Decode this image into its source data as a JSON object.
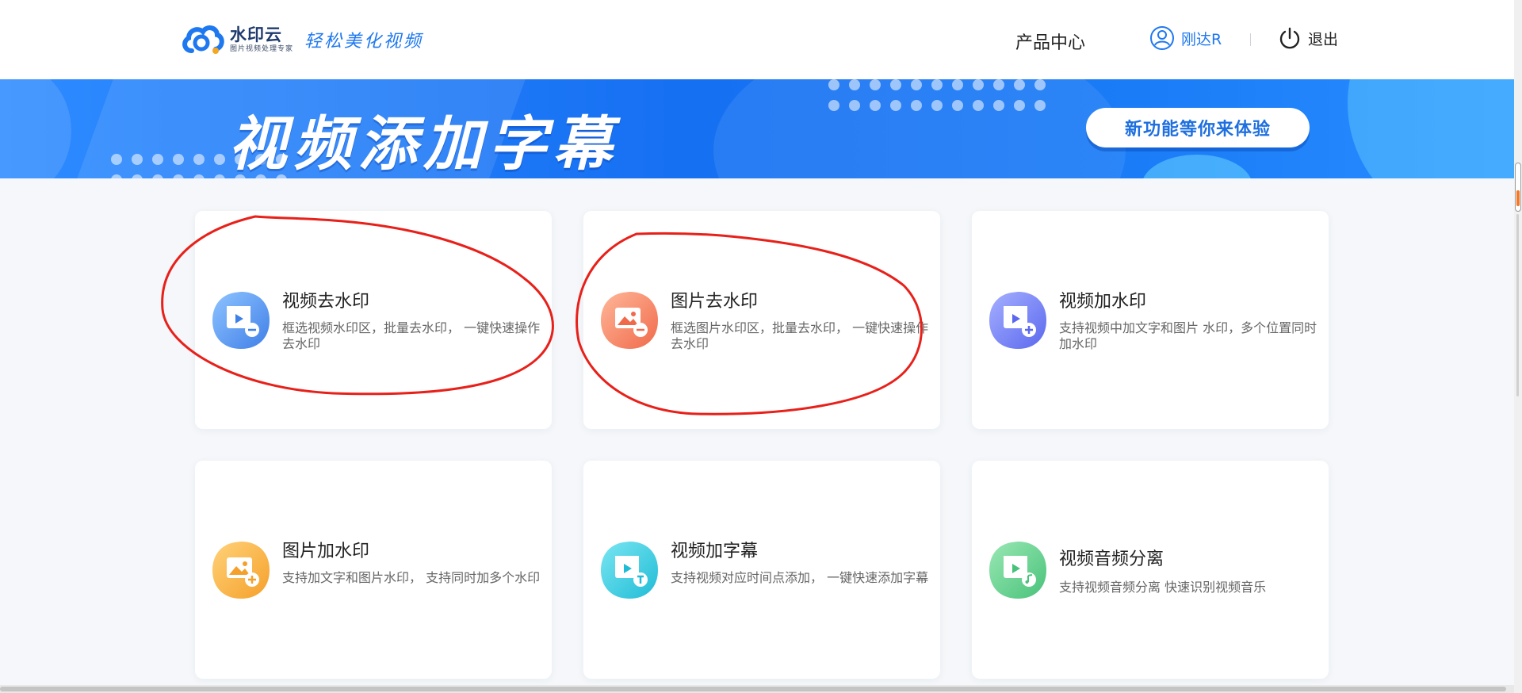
{
  "header": {
    "logo_name": "水印云",
    "logo_sub": "图片视频处理专家",
    "slogan": "轻松美化视频",
    "nav_products": "产品中心",
    "user_name": "刚达R",
    "logout_label": "退出"
  },
  "banner": {
    "title": "视频添加字幕",
    "button_label": "新功能等你来体验"
  },
  "cards": [
    {
      "title": "视频去水印",
      "desc": "框选视频水印区，批量去水印， 一键快速操作去水印",
      "icon": "video-remove-icon",
      "color": "#4a90f0"
    },
    {
      "title": "图片去水印",
      "desc": "框选图片水印区，批量去水印， 一键快速操作去水印",
      "icon": "image-remove-icon",
      "color": "#f57c5a"
    },
    {
      "title": "视频加水印",
      "desc": "支持视频中加文字和图片 水印，多个位置同时加水印",
      "icon": "video-add-icon",
      "color": "#6a78f0"
    },
    {
      "title": "图片加水印",
      "desc": "支持加文字和图片水印， 支持同时加多个水印",
      "icon": "image-add-icon",
      "color": "#f7a634"
    },
    {
      "title": "视频加字幕",
      "desc": "支持视频对应时间点添加， 一键快速添加字幕",
      "icon": "video-subtitle-icon",
      "color": "#2fc8dc"
    },
    {
      "title": "视频音频分离",
      "desc": "支持视频音频分离 快速识别视频音乐",
      "icon": "video-audio-icon",
      "color": "#5cd08a"
    }
  ],
  "colors": {
    "accent": "#1e78f0",
    "annotation": "#e8201a"
  }
}
